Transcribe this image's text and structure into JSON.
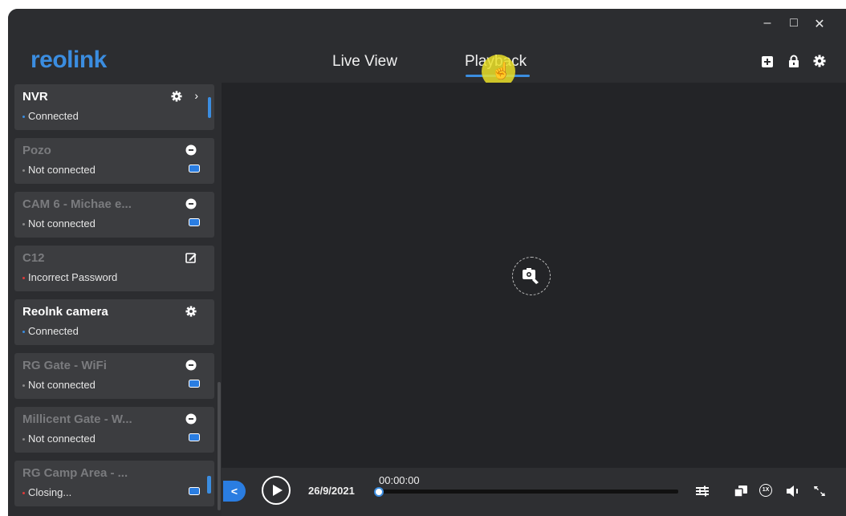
{
  "app": {
    "logo": "reolink",
    "accent": "#3b8de0",
    "window_controls": {
      "minimize": "–",
      "maximize": "□",
      "close": "✕"
    }
  },
  "tabs": [
    {
      "label": "Live View",
      "active": false
    },
    {
      "label": "Playback",
      "active": true
    }
  ],
  "toolbar_icons": [
    "add-icon",
    "lock-icon",
    "settings-icon"
  ],
  "devices": [
    {
      "name": "NVR",
      "status": "Connected",
      "status_color": "#3b8de0",
      "online": true
    },
    {
      "name": "Pozo",
      "status": "Not connected",
      "status_color": "#8a8a8a",
      "online": false
    },
    {
      "name": "CAM 6 - Michae e...",
      "status": "Not connected",
      "status_color": "#8a8a8a",
      "online": false
    },
    {
      "name": "C12",
      "status": "Incorrect Password",
      "status_color": "#e03a3a",
      "online": false
    },
    {
      "name": "Reolnk camera",
      "status": "Connected",
      "status_color": "#3b8de0",
      "online": true
    },
    {
      "name": "RG Gate - WiFi",
      "status": "Not connected",
      "status_color": "#8a8a8a",
      "online": false
    },
    {
      "name": "Millicent Gate - W...",
      "status": "Not connected",
      "status_color": "#8a8a8a",
      "online": false
    },
    {
      "name": "RG Camp Area - ...",
      "status": "Closing...",
      "status_color": "#e03a3a",
      "online": false
    }
  ],
  "player": {
    "date": "26/9/2021",
    "time": "00:00:00",
    "progress": 0.0,
    "back_label": "<",
    "speed_label": "1X"
  }
}
